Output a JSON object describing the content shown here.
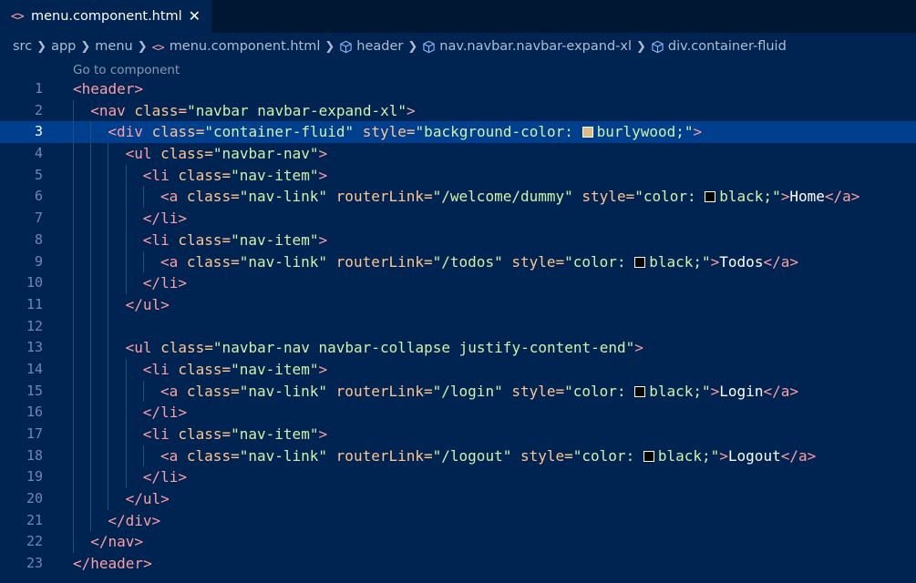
{
  "tab": {
    "label": "menu.component.html",
    "icon": "html-file-icon",
    "icon_glyph": "<>",
    "close_glyph": "✕"
  },
  "breadcrumb": [
    "src",
    "app",
    "menu",
    "menu.component.html",
    "header",
    "nav.navbar.navbar-expand-xl",
    "div.container-fluid"
  ],
  "codelens": "Go to component",
  "colors": {
    "accent_background": "#002451",
    "tag": "#ff9da4",
    "attribute": "#ffc58f",
    "string": "#d1f1a9",
    "burlywood": "#deb887",
    "black": "#000000"
  },
  "editor": {
    "current_line": 3,
    "lines": [
      {
        "n": "1",
        "tokens": [
          [
            "t",
            "<header>"
          ]
        ]
      },
      {
        "n": "2",
        "tokens": [
          [
            "t",
            "<nav "
          ],
          [
            "a",
            "class="
          ],
          [
            "s",
            "\"navbar navbar-expand-xl\""
          ],
          [
            "t",
            ">"
          ]
        ]
      },
      {
        "n": "3",
        "tokens": [
          [
            "t",
            "<div "
          ],
          [
            "a",
            "class="
          ],
          [
            "s",
            "\"container-fluid\" "
          ],
          [
            "a",
            "style="
          ],
          [
            "s",
            "\"background-color: "
          ],
          [
            "sw",
            "#deb887"
          ],
          [
            "s",
            "burlywood;\""
          ],
          [
            "t",
            ">"
          ]
        ]
      },
      {
        "n": "4",
        "tokens": [
          [
            "t",
            "<ul "
          ],
          [
            "a",
            "class="
          ],
          [
            "s",
            "\"navbar-nav\""
          ],
          [
            "t",
            ">"
          ]
        ]
      },
      {
        "n": "5",
        "tokens": [
          [
            "t",
            "<li "
          ],
          [
            "a",
            "class="
          ],
          [
            "s",
            "\"nav-item\""
          ],
          [
            "t",
            ">"
          ]
        ]
      },
      {
        "n": "6",
        "tokens": [
          [
            "t",
            "<a "
          ],
          [
            "a",
            "class="
          ],
          [
            "s",
            "\"nav-link\" "
          ],
          [
            "a",
            "routerLink="
          ],
          [
            "s",
            "\"/welcome/dummy\" "
          ],
          [
            "a",
            "style="
          ],
          [
            "s",
            "\"color: "
          ],
          [
            "sw",
            "#000000"
          ],
          [
            "s",
            "black;\""
          ],
          [
            "t",
            ">"
          ],
          [
            "p",
            "Home"
          ],
          [
            "t",
            "</a>"
          ]
        ]
      },
      {
        "n": "7",
        "tokens": [
          [
            "t",
            "</li>"
          ]
        ]
      },
      {
        "n": "8",
        "tokens": [
          [
            "t",
            "<li "
          ],
          [
            "a",
            "class="
          ],
          [
            "s",
            "\"nav-item\""
          ],
          [
            "t",
            ">"
          ]
        ]
      },
      {
        "n": "9",
        "tokens": [
          [
            "t",
            "<a "
          ],
          [
            "a",
            "class="
          ],
          [
            "s",
            "\"nav-link\" "
          ],
          [
            "a",
            "routerLink="
          ],
          [
            "s",
            "\"/todos\" "
          ],
          [
            "a",
            "style="
          ],
          [
            "s",
            "\"color: "
          ],
          [
            "sw",
            "#000000"
          ],
          [
            "s",
            "black;\""
          ],
          [
            "t",
            ">"
          ],
          [
            "p",
            "Todos"
          ],
          [
            "t",
            "</a>"
          ]
        ]
      },
      {
        "n": "10",
        "tokens": [
          [
            "t",
            "</li>"
          ]
        ]
      },
      {
        "n": "11",
        "tokens": [
          [
            "t",
            "</ul>"
          ]
        ]
      },
      {
        "n": "12",
        "tokens": []
      },
      {
        "n": "13",
        "tokens": [
          [
            "t",
            "<ul "
          ],
          [
            "a",
            "class="
          ],
          [
            "s",
            "\"navbar-nav navbar-collapse justify-content-end\""
          ],
          [
            "t",
            ">"
          ]
        ]
      },
      {
        "n": "14",
        "tokens": [
          [
            "t",
            "<li "
          ],
          [
            "a",
            "class="
          ],
          [
            "s",
            "\"nav-item\""
          ],
          [
            "t",
            ">"
          ]
        ]
      },
      {
        "n": "15",
        "tokens": [
          [
            "t",
            "<a "
          ],
          [
            "a",
            "class="
          ],
          [
            "s",
            "\"nav-link\" "
          ],
          [
            "a",
            "routerLink="
          ],
          [
            "s",
            "\"/login\" "
          ],
          [
            "a",
            "style="
          ],
          [
            "s",
            "\"color: "
          ],
          [
            "sw",
            "#000000"
          ],
          [
            "s",
            "black;\""
          ],
          [
            "t",
            ">"
          ],
          [
            "p",
            "Login"
          ],
          [
            "t",
            "</a>"
          ]
        ]
      },
      {
        "n": "16",
        "tokens": [
          [
            "t",
            "</li>"
          ]
        ]
      },
      {
        "n": "17",
        "tokens": [
          [
            "t",
            "<li "
          ],
          [
            "a",
            "class="
          ],
          [
            "s",
            "\"nav-item\""
          ],
          [
            "t",
            ">"
          ]
        ]
      },
      {
        "n": "18",
        "tokens": [
          [
            "t",
            "<a "
          ],
          [
            "a",
            "class="
          ],
          [
            "s",
            "\"nav-link\" "
          ],
          [
            "a",
            "routerLink="
          ],
          [
            "s",
            "\"/logout\" "
          ],
          [
            "a",
            "style="
          ],
          [
            "s",
            "\"color: "
          ],
          [
            "sw",
            "#000000"
          ],
          [
            "s",
            "black;\""
          ],
          [
            "t",
            ">"
          ],
          [
            "p",
            "Logout"
          ],
          [
            "t",
            "</a>"
          ]
        ]
      },
      {
        "n": "19",
        "tokens": [
          [
            "t",
            "</li>"
          ]
        ]
      },
      {
        "n": "20",
        "tokens": [
          [
            "t",
            "</ul>"
          ]
        ]
      },
      {
        "n": "21",
        "tokens": [
          [
            "t",
            "</div>"
          ]
        ]
      },
      {
        "n": "22",
        "tokens": [
          [
            "t",
            "</nav>"
          ]
        ]
      },
      {
        "n": "23",
        "tokens": [
          [
            "t",
            "</header>"
          ]
        ]
      }
    ]
  }
}
